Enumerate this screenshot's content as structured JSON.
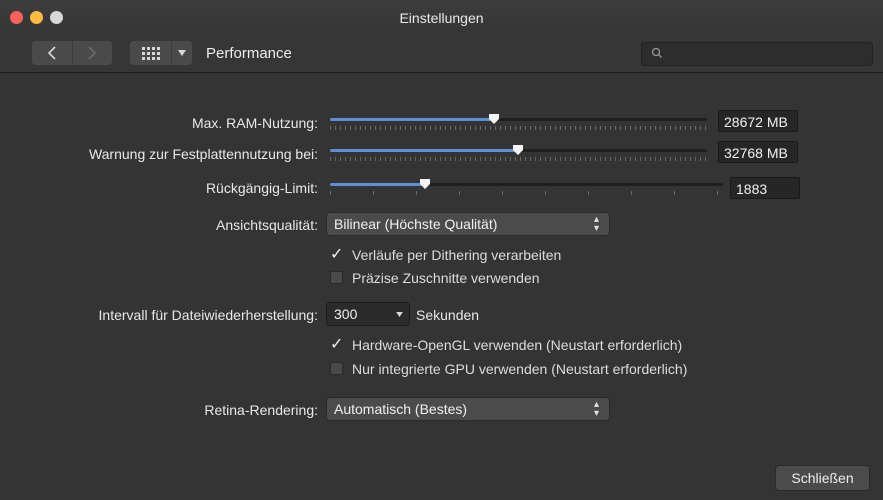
{
  "window": {
    "title": "Einstellungen"
  },
  "toolbar": {
    "back_icon": "chevron-left-icon",
    "forward_icon": "chevron-right-icon",
    "grid_icon": "grid-icon",
    "panel_name": "Performance",
    "search_placeholder": ""
  },
  "settings": {
    "ram": {
      "label": "Max. RAM-Nutzung:",
      "value": "28672 MB",
      "slider_fraction": 0.42
    },
    "disk_warning": {
      "label": "Warnung zur Festplattennutzung bei:",
      "value": "32768 MB",
      "slider_fraction": 0.49
    },
    "undo_limit": {
      "label": "Rückgängig-Limit:",
      "value": "1883",
      "slider_fraction": 0.24
    },
    "view_quality": {
      "label": "Ansichtsqualität:",
      "selected": "Bilinear (Höchste Qualität)"
    },
    "dithering": {
      "label": "Verläufe per Dithering verarbeiten",
      "checked": true
    },
    "precise_clipping": {
      "label": "Präzise Zuschnitte verwenden",
      "checked": false
    },
    "recovery_interval": {
      "label": "Intervall für Dateiwiederherstellung:",
      "value": "300",
      "unit": "Sekunden"
    },
    "hardware_opengl": {
      "label": "Hardware-OpenGL verwenden (Neustart erforderlich)",
      "checked": true
    },
    "integrated_gpu": {
      "label": "Nur integrierte GPU verwenden (Neustart erforderlich)",
      "checked": false
    },
    "retina": {
      "label": "Retina-Rendering:",
      "selected": "Automatisch (Bestes)"
    }
  },
  "footer": {
    "close_label": "Schließen"
  },
  "colors": {
    "accent": "#5e8ed8",
    "close": "#fc605b",
    "minimize": "#fdbc40"
  }
}
